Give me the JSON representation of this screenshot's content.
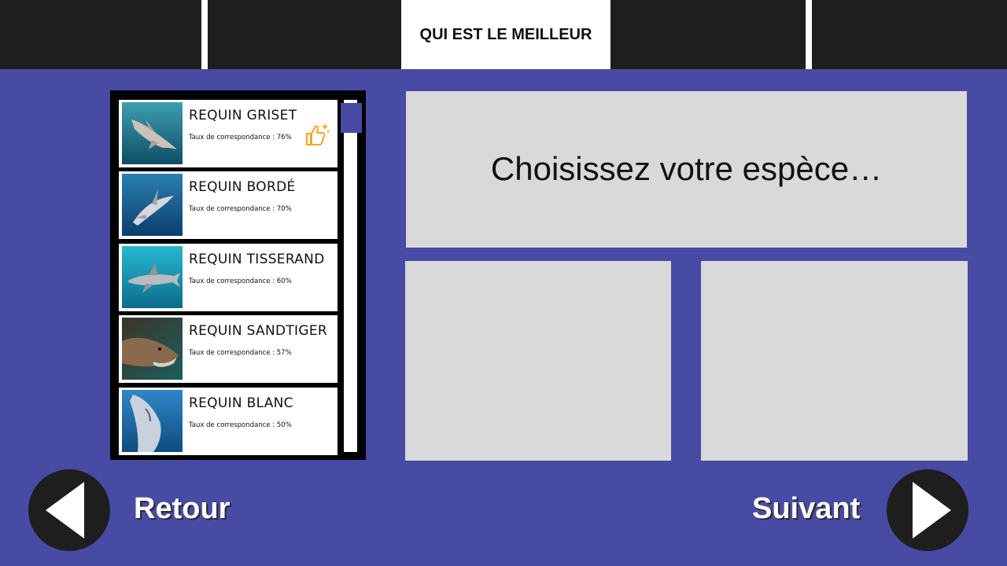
{
  "header": {
    "active_tab_label": "QUI EST LE MEILLEUR"
  },
  "species_list": {
    "items": [
      {
        "name": "REQUIN GRISET",
        "match": "Taux de correspondance : 76%",
        "thumb_icon": "shark-photo",
        "badge_icon": "thumbs-up-icon"
      },
      {
        "name": "REQUIN BORDÉ",
        "match": "Taux de correspondance : 70%",
        "thumb_icon": "shark-photo"
      },
      {
        "name": "REQUIN TISSERAND",
        "match": "Taux de correspondance : 60%",
        "thumb_icon": "shark-photo"
      },
      {
        "name": "REQUIN SANDTIGER",
        "match": "Taux de correspondance : 57%",
        "thumb_icon": "shark-photo"
      },
      {
        "name": "REQUIN BLANC",
        "match": "Taux de correspondance : 50%",
        "thumb_icon": "shark-photo"
      }
    ]
  },
  "main": {
    "prompt": "Choisissez votre espèce…"
  },
  "navigation": {
    "back_label": "Retour",
    "next_label": "Suivant",
    "back_icon": "triangle-left-icon",
    "next_icon": "triangle-right-icon"
  },
  "colors": {
    "background": "#474ba3",
    "topbar": "#1e1e1e",
    "panel": "#d9d9d9",
    "badge": "#f5a623"
  }
}
